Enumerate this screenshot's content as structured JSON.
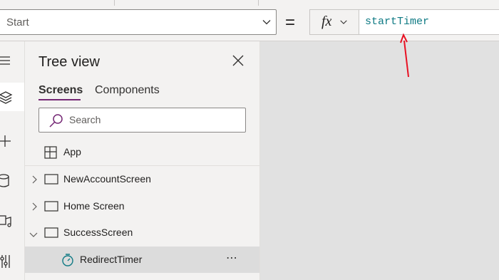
{
  "formula_bar": {
    "property": "Start",
    "equals": "=",
    "fx_label": "fx",
    "formula": "startTimer"
  },
  "tree_view": {
    "title": "Tree view",
    "tabs": [
      {
        "label": "Screens",
        "active": true
      },
      {
        "label": "Components",
        "active": false
      }
    ],
    "search_placeholder": "Search",
    "nodes": [
      {
        "label": "App",
        "icon": "app-icon"
      },
      {
        "label": "NewAccountScreen",
        "icon": "screen-icon",
        "expanded": false
      },
      {
        "label": "Home Screen",
        "icon": "screen-icon",
        "expanded": false
      },
      {
        "label": "SuccessScreen",
        "icon": "screen-icon",
        "expanded": true
      },
      {
        "label": "RedirectTimer",
        "icon": "timer-icon",
        "selected": true,
        "more": "⋯"
      }
    ]
  },
  "left_rail": [
    "hamburger-icon",
    "layers-icon",
    "plus-icon",
    "data-icon",
    "media-icon",
    "tools-icon"
  ],
  "colors": {
    "accent": "#742774",
    "formula_text": "#0f7a84",
    "annotation_arrow": "#e81123",
    "timer_icon": "#0f7a84"
  }
}
